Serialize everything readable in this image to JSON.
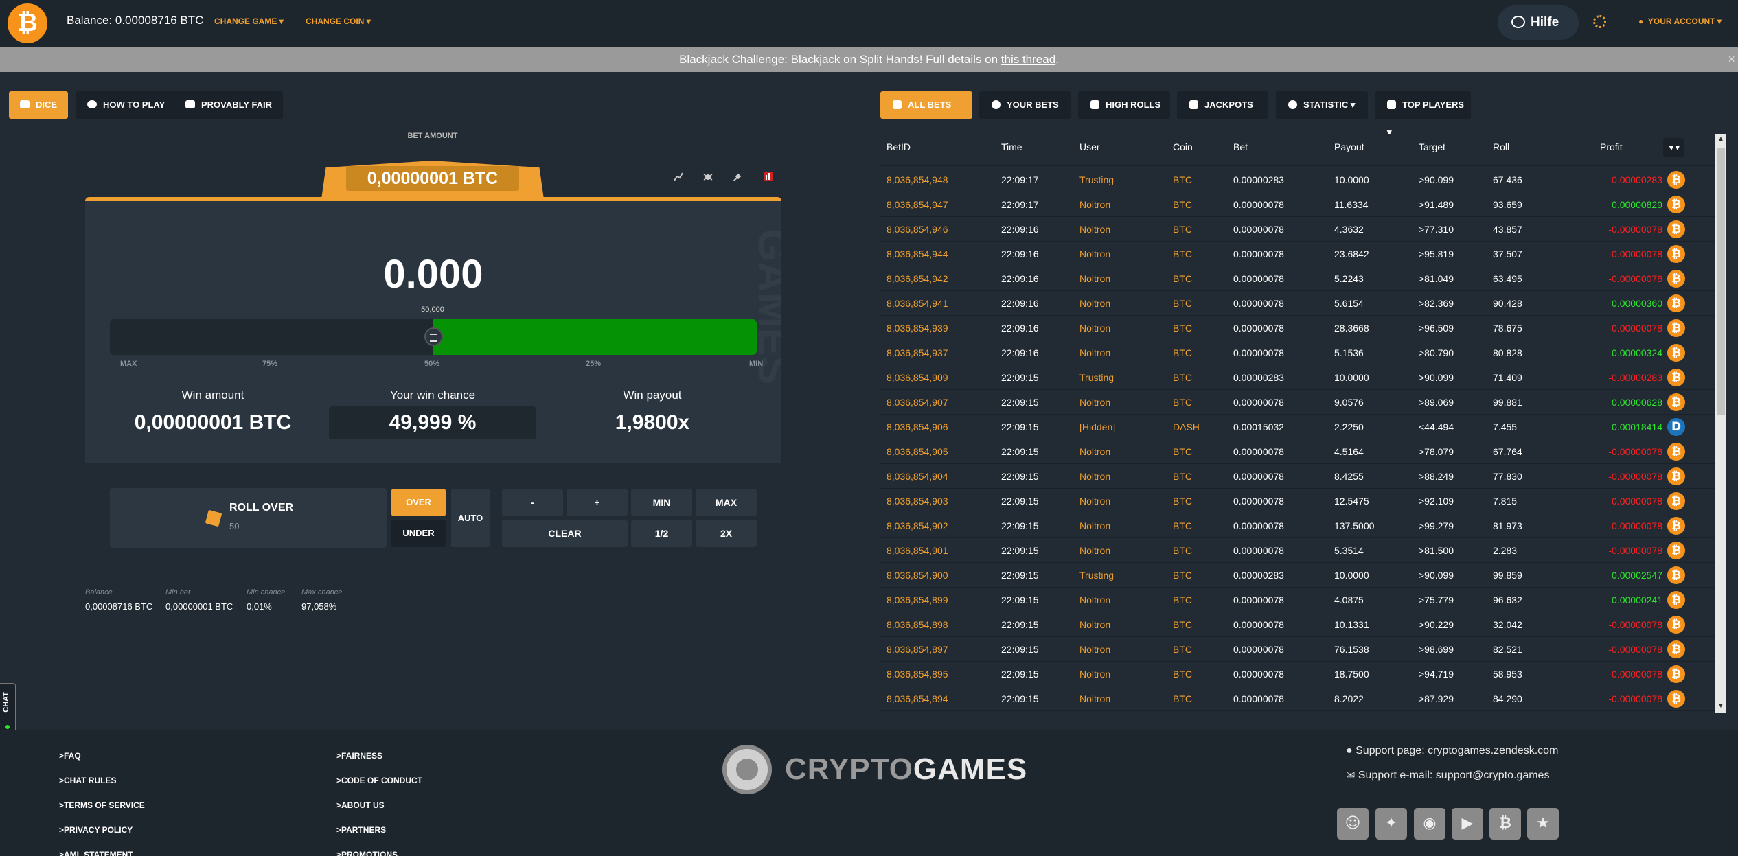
{
  "header": {
    "logo_glyph": "₿",
    "balance": "Balance: 0.00008716 BTC",
    "change_game": "CHANGE GAME",
    "change_coin": "CHANGE COIN",
    "help": "Hilfe",
    "account": "YOUR ACCOUNT"
  },
  "banner": {
    "text": "Blackjack Challenge: Blackjack on Split Hands! Full details on ",
    "link": "this thread",
    "suffix": ".",
    "close": "×"
  },
  "game_tabs": [
    "DICE",
    "HOW TO PLAY",
    "PROVABLY FAIR"
  ],
  "bet": {
    "label": "BET AMOUNT",
    "amount": "0,00000001 BTC",
    "roll_value": "0.000",
    "slider_value": "50,000",
    "slider_position_pct": 50,
    "ticks": [
      "MAX",
      "75%",
      "50%",
      "25%",
      "MIN"
    ],
    "watermark": "CRYPTO GAMES"
  },
  "stats": {
    "win_amount_label": "Win amount",
    "win_amount": "0,00000001 BTC",
    "win_chance_label": "Your win chance",
    "win_chance": "49,999 %",
    "win_payout_label": "Win payout",
    "win_payout": "1,9800x"
  },
  "controls": {
    "roll_over": "ROLL OVER",
    "roll_over_value": "50",
    "over": "OVER",
    "under": "UNDER",
    "auto": "AUTO",
    "minus": "-",
    "plus": "+",
    "min": "MIN",
    "max": "MAX",
    "clear": "CLEAR",
    "half": "1/2",
    "double": "2X"
  },
  "bet_info": {
    "balance_label": "Balance",
    "balance": "0,00008716 BTC",
    "min_bet_label": "Min bet",
    "min_bet": "0,00000001 BTC",
    "min_chance_label": "Min chance",
    "min_chance": "0,01%",
    "max_chance_label": "Max chance",
    "max_chance": "97,058%"
  },
  "bet_tabs": [
    "ALL BETS",
    "YOUR BETS",
    "HIGH ROLLS",
    "JACKPOTS",
    "STATISTIC",
    "TOP PLAYERS"
  ],
  "table": {
    "columns": [
      "BetID",
      "Time",
      "User",
      "Coin",
      "Bet",
      "Payout",
      "Target",
      "Roll",
      "Profit"
    ],
    "rows": [
      [
        "8,036,854,948",
        "22:09:17",
        "Trusting",
        "BTC",
        "0.00000283",
        "10.0000",
        ">90.099",
        "67.436",
        "-0.00000283"
      ],
      [
        "8,036,854,947",
        "22:09:17",
        "Noltron",
        "BTC",
        "0.00000078",
        "11.6334",
        ">91.489",
        "93.659",
        "0.00000829"
      ],
      [
        "8,036,854,946",
        "22:09:16",
        "Noltron",
        "BTC",
        "0.00000078",
        "4.3632",
        ">77.310",
        "43.857",
        "-0.00000078"
      ],
      [
        "8,036,854,944",
        "22:09:16",
        "Noltron",
        "BTC",
        "0.00000078",
        "23.6842",
        ">95.819",
        "37.507",
        "-0.00000078"
      ],
      [
        "8,036,854,942",
        "22:09:16",
        "Noltron",
        "BTC",
        "0.00000078",
        "5.2243",
        ">81.049",
        "63.495",
        "-0.00000078"
      ],
      [
        "8,036,854,941",
        "22:09:16",
        "Noltron",
        "BTC",
        "0.00000078",
        "5.6154",
        ">82.369",
        "90.428",
        "0.00000360"
      ],
      [
        "8,036,854,939",
        "22:09:16",
        "Noltron",
        "BTC",
        "0.00000078",
        "28.3668",
        ">96.509",
        "78.675",
        "-0.00000078"
      ],
      [
        "8,036,854,937",
        "22:09:16",
        "Noltron",
        "BTC",
        "0.00000078",
        "5.1536",
        ">80.790",
        "80.828",
        "0.00000324"
      ],
      [
        "8,036,854,909",
        "22:09:15",
        "Trusting",
        "BTC",
        "0.00000283",
        "10.0000",
        ">90.099",
        "71.409",
        "-0.00000283"
      ],
      [
        "8,036,854,907",
        "22:09:15",
        "Noltron",
        "BTC",
        "0.00000078",
        "9.0576",
        ">89.069",
        "99.881",
        "0.00000628"
      ],
      [
        "8,036,854,906",
        "22:09:15",
        "[Hidden]",
        "DASH",
        "0.00015032",
        "2.2250",
        "<44.494",
        "7.455",
        "0.00018414"
      ],
      [
        "8,036,854,905",
        "22:09:15",
        "Noltron",
        "BTC",
        "0.00000078",
        "4.5164",
        ">78.079",
        "67.764",
        "-0.00000078"
      ],
      [
        "8,036,854,904",
        "22:09:15",
        "Noltron",
        "BTC",
        "0.00000078",
        "8.4255",
        ">88.249",
        "77.830",
        "-0.00000078"
      ],
      [
        "8,036,854,903",
        "22:09:15",
        "Noltron",
        "BTC",
        "0.00000078",
        "12.5475",
        ">92.109",
        "7.815",
        "-0.00000078"
      ],
      [
        "8,036,854,902",
        "22:09:15",
        "Noltron",
        "BTC",
        "0.00000078",
        "137.5000",
        ">99.279",
        "81.973",
        "-0.00000078"
      ],
      [
        "8,036,854,901",
        "22:09:15",
        "Noltron",
        "BTC",
        "0.00000078",
        "5.3514",
        ">81.500",
        "2.283",
        "-0.00000078"
      ],
      [
        "8,036,854,900",
        "22:09:15",
        "Trusting",
        "BTC",
        "0.00000283",
        "10.0000",
        ">90.099",
        "99.859",
        "0.00002547"
      ],
      [
        "8,036,854,899",
        "22:09:15",
        "Noltron",
        "BTC",
        "0.00000078",
        "4.0875",
        ">75.779",
        "96.632",
        "0.00000241"
      ],
      [
        "8,036,854,898",
        "22:09:15",
        "Noltron",
        "BTC",
        "0.00000078",
        "10.1331",
        ">90.229",
        "32.042",
        "-0.00000078"
      ],
      [
        "8,036,854,897",
        "22:09:15",
        "Noltron",
        "BTC",
        "0.00000078",
        "76.1538",
        ">98.699",
        "82.521",
        "-0.00000078"
      ],
      [
        "8,036,854,895",
        "22:09:15",
        "Noltron",
        "BTC",
        "0.00000078",
        "18.7500",
        ">94.719",
        "58.953",
        "-0.00000078"
      ],
      [
        "8,036,854,894",
        "22:09:15",
        "Noltron",
        "BTC",
        "0.00000078",
        "8.2022",
        ">87.929",
        "84.290",
        "-0.00000078"
      ]
    ]
  },
  "chat_label": "CHAT",
  "footer": {
    "col1": [
      ">FAQ",
      ">CHAT RULES",
      ">TERMS OF SERVICE",
      ">PRIVACY POLICY",
      ">AML STATEMENT"
    ],
    "col2": [
      ">FAIRNESS",
      ">CODE OF CONDUCT",
      ">ABOUT US",
      ">PARTNERS",
      ">PROMOTIONS"
    ],
    "brand_a": "CRYPTO",
    "brand_b": "GAMES",
    "support_page": "Support page: cryptogames.zendesk.com",
    "support_email": "Support e-mail: support@crypto.games",
    "social_icons": [
      "reddit-icon",
      "twitter-icon",
      "discord-icon",
      "youtube-icon",
      "bitcointalk-icon",
      "trustpilot-icon"
    ]
  },
  "colors": {
    "accent": "#f0a030",
    "win": "#2ce62c",
    "loss": "#ff2020",
    "slider": "#059305"
  }
}
